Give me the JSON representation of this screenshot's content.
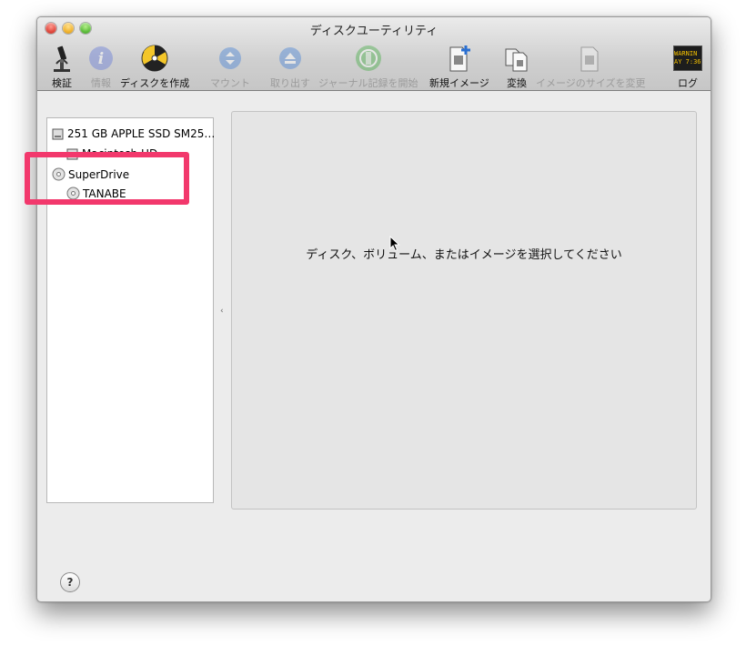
{
  "window": {
    "title": "ディスクユーティリティ"
  },
  "toolbar": {
    "items": [
      {
        "label": "検証",
        "icon": "microscope-icon",
        "enabled": true
      },
      {
        "label": "情報",
        "icon": "info-icon",
        "enabled": false
      },
      {
        "label": "ディスクを作成",
        "icon": "burn-icon",
        "enabled": true
      },
      {
        "label": "マウント",
        "icon": "mount-icon",
        "enabled": false
      },
      {
        "label": "取り出す",
        "icon": "eject-icon",
        "enabled": false
      },
      {
        "label": "ジャーナル記録を開始",
        "icon": "journal-icon",
        "enabled": false
      },
      {
        "label": "新規イメージ",
        "icon": "new-image-icon",
        "enabled": true
      },
      {
        "label": "変換",
        "icon": "convert-icon",
        "enabled": true
      },
      {
        "label": "イメージのサイズを変更",
        "icon": "resize-image-icon",
        "enabled": false
      },
      {
        "label": "ログ",
        "icon": "log-icon",
        "enabled": true
      }
    ],
    "log_icon_text": [
      "WARNIN",
      "AY 7:36"
    ]
  },
  "sidebar": {
    "items": [
      {
        "label": "251 GB APPLE SSD SM25…",
        "icon": "internal-disk-icon",
        "level": 0
      },
      {
        "label": "Macintosh HD",
        "icon": "volume-icon",
        "level": 1
      },
      {
        "label": "SuperDrive",
        "icon": "optical-drive-icon",
        "level": 0
      },
      {
        "label": "TANABE",
        "icon": "optical-disc-icon",
        "level": 1
      }
    ]
  },
  "detail": {
    "message": "ディスク、ボリューム、またはイメージを選択してください"
  },
  "help": {
    "label": "?"
  },
  "colors": {
    "highlight": "#f2386c",
    "window_bg": "#ececec"
  }
}
